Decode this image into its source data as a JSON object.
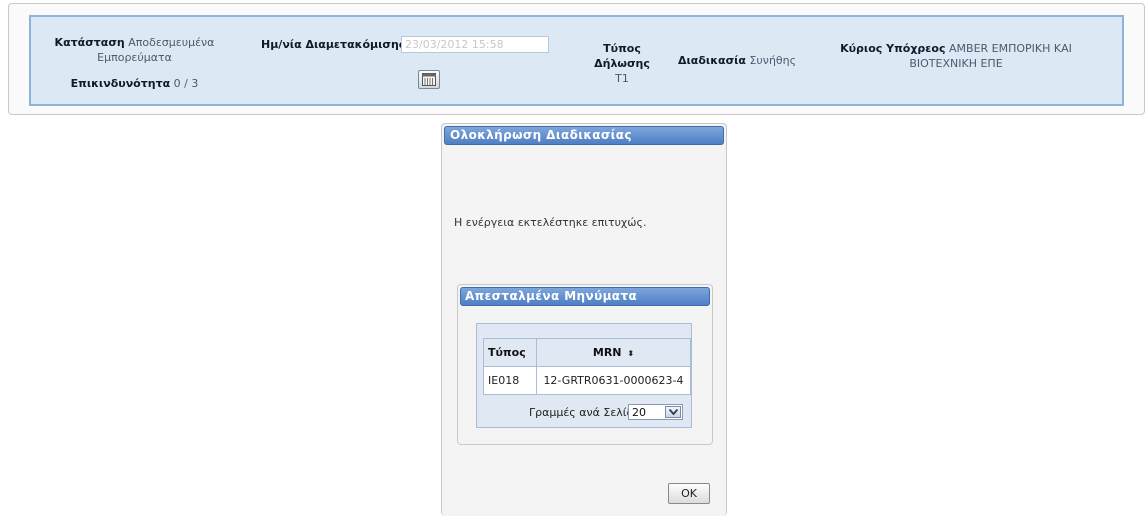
{
  "header": {
    "status_label": "Κατάσταση",
    "status_value_line1": "Αποδεσμευμένα",
    "status_value_line2": "Εμπορεύματα",
    "risk_label": "Επικινδυνότητα",
    "risk_value": "0 / 3",
    "transit_date_label": "Ημ/νία Διαμετακόμισης",
    "transit_date_value": "23/03/2012 15:58",
    "declaration_type_label_line1": "Τύπος",
    "declaration_type_label_line2": "Δήλωσης",
    "declaration_type_value": "T1",
    "procedure_label": "Διαδικασία",
    "procedure_value": "Συνήθης",
    "principal_label": "Κύριος Υπόχρεος",
    "principal_value_line1": "AMBER ΕΜΠΟΡΙΚΗ ΚΑΙ",
    "principal_value_line2": "ΒΙΟΤΕΧΝΙΚΗ ΕΠΕ",
    "calendar_icon": "calendar-icon"
  },
  "dialog": {
    "title": "Ολοκλήρωση Διαδικασίας",
    "message": "Η ενέργεια εκτελέστηκε επιτυχώς.",
    "sent_messages": {
      "title": "Απεσταλμένα Μηνύματα",
      "columns": [
        "Τύπος",
        "MRN"
      ],
      "sort_icon": "⬍",
      "rows": [
        {
          "type": "IE018",
          "mrn": "12-GRTR0631-0000623-4"
        }
      ],
      "rows_per_page_label": "Γραμμές ανά Σελίδα",
      "rows_per_page_value": "20"
    },
    "ok_label": "OK"
  },
  "colors": {
    "header_bg": "#dde8f5",
    "header_border": "#8eb4dc",
    "titlebar_top": "#7ea6dc",
    "titlebar_bottom": "#4f7ec4"
  }
}
